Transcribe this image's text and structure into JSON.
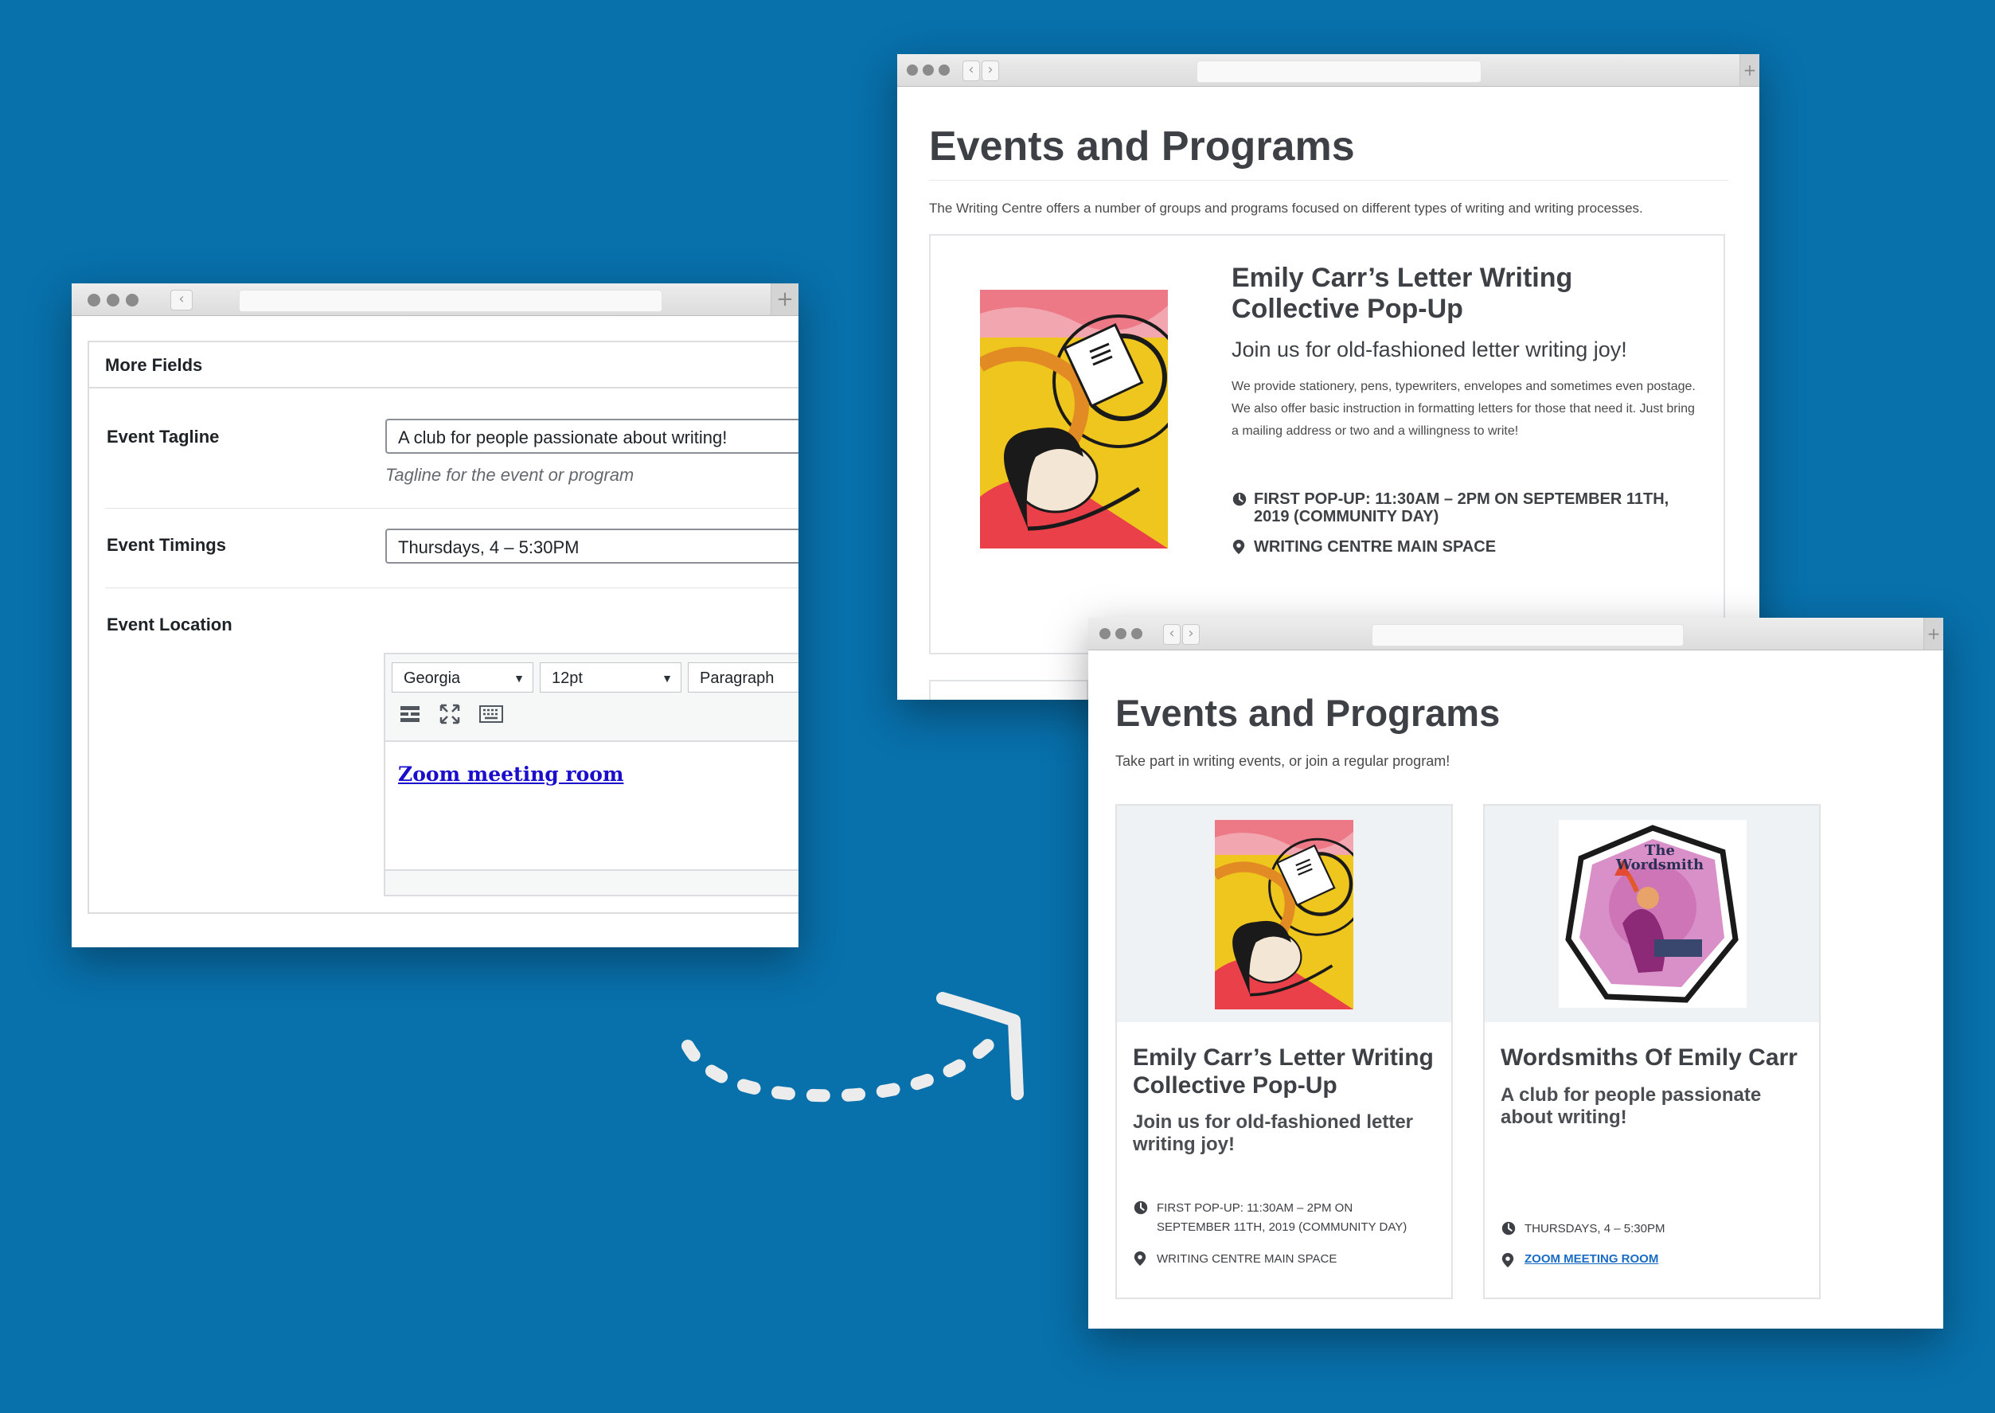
{
  "admin": {
    "panel_title": "More Fields",
    "tagline_label": "Event Tagline",
    "tagline_value": "A club for people passionate about writing!",
    "tagline_hint": "Tagline for the event or program",
    "timings_label": "Event Timings",
    "timings_value": "Thursdays, 4 – 5:30PM",
    "location_label": "Event Location",
    "font_select": "Georgia",
    "size_select": "12pt",
    "format_select": "Paragraph",
    "location_link": "Zoom meeting room"
  },
  "site1": {
    "title": "Events and Programs",
    "intro": "The Writing Centre offers a number of groups and programs focused on different types of writing and writing processes.",
    "event": {
      "title": "Emily Carr’s Letter Writing Collective Pop-Up",
      "tagline": "Join us for old-fashioned letter writing joy!",
      "description": "We provide stationery, pens, typewriters, envelopes and sometimes even postage. We also offer basic instruction in formatting letters for those that need it. Just bring a mailing address or two and a willingness to write!",
      "time_line1": "First Pop-Up: 11:30am – 2pm on September 11th,",
      "time_line2": "2019 (Community Day)",
      "location": "Writing Centre Main Space"
    }
  },
  "site2": {
    "title": "Events and Programs",
    "intro": "Take part in writing events, or join a regular program!",
    "cards": [
      {
        "title_line1": "Emily Carr’s Letter Writing",
        "title_line2": "Collective Pop-Up",
        "tagline_line1": "Join us for old-fashioned letter",
        "tagline_line2": "writing joy!",
        "time_line1": "First Pop-Up: 11:30am – 2pm on",
        "time_line2": "September 11th, 2019 (Community Day)",
        "location": "Writing Centre Main Space"
      },
      {
        "title": "Wordsmiths Of Emily Carr",
        "tagline_line1": "A club for people passionate",
        "tagline_line2": "about writing!",
        "time": "Thursdays, 4 – 5:30PM",
        "location": "Zoom meeting room",
        "poster_text": "The Wordsmith"
      }
    ]
  },
  "icons": [
    "clock-icon",
    "location-pin-icon",
    "chevron-left-icon",
    "chevron-right-icon",
    "plus-icon",
    "table-icon",
    "fullscreen-icon",
    "keyboard-icon",
    "arrow-icon"
  ],
  "colors": {
    "background": "#0870ab",
    "link": "#1a6cc4",
    "admin_link": "#1a0dcc"
  }
}
